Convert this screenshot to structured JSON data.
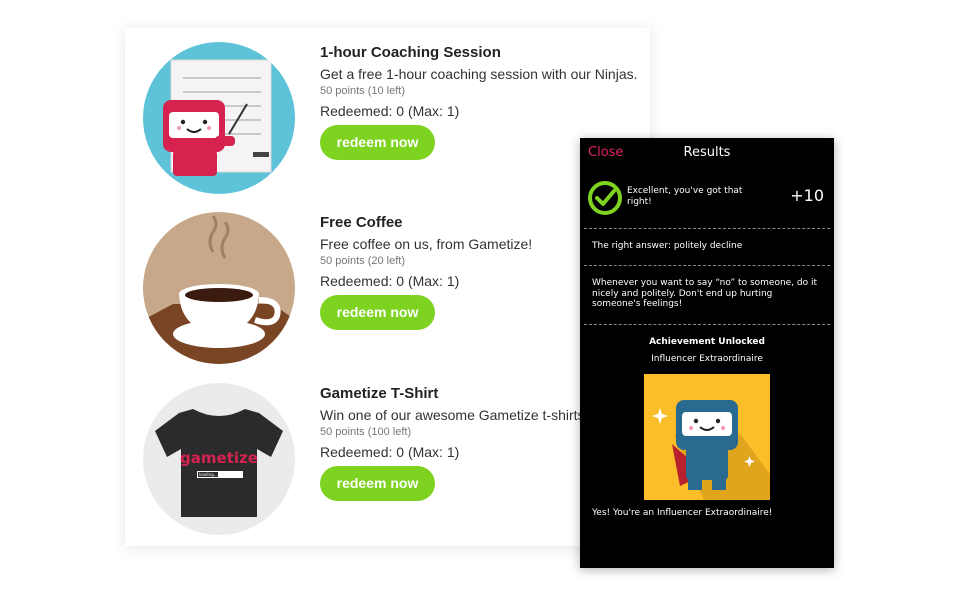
{
  "rewards": [
    {
      "title": "1-hour Coaching Session",
      "description": "Get a free 1-hour coaching session with our Ninjas.",
      "points": "50 points (10 left)",
      "redeemed": "Redeemed: 0 (Max: 1)",
      "button": "redeem now"
    },
    {
      "title": "Free Coffee",
      "description": "Free coffee on us, from Gametize!",
      "points": "50 points (20 left)",
      "redeemed": "Redeemed: 0 (Max: 1)",
      "button": "redeem now"
    },
    {
      "title": "Gametize T-Shirt",
      "description": "Win one of our awesome Gametize t-shirts!",
      "points": "50 points (100 left)",
      "redeemed": "Redeemed: 0 (Max: 1)",
      "button": "redeem now",
      "shirt_text": "gametize",
      "shirt_bar": "loading..."
    }
  ],
  "results": {
    "close": "Close",
    "title": "Results",
    "message": "Excellent, you've got that right!",
    "score": "+10",
    "answer": "The right answer: politely decline",
    "explanation": "Whenever you want to say “no” to someone, do it nicely and politely. Don't end up hurting someone's feelings!",
    "achievement_title": "Achievement Unlocked",
    "achievement_name": "Influencer Extraordinaire",
    "congrats": "Yes! You're an Influencer Extraordinaire!"
  },
  "colors": {
    "accent_green": "#7ed321",
    "close_pink": "#e2255c",
    "check_green": "#7ed321",
    "badge_yellow": "#fbbd28"
  },
  "icons": [
    "check-circle-icon",
    "ninja-coaching-illustration",
    "coffee-cup-illustration",
    "tshirt-illustration",
    "ninja-hero-badge"
  ]
}
